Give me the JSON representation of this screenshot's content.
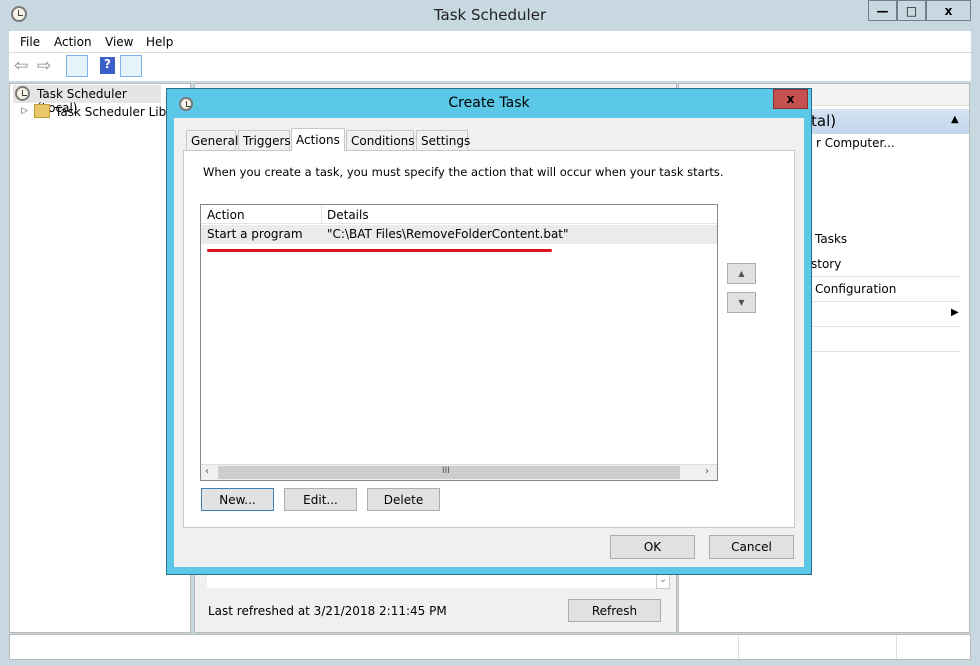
{
  "window": {
    "title": "Task Scheduler",
    "controls": {
      "minimize": "—",
      "maximize": "□",
      "close": "x"
    }
  },
  "menu": [
    "File",
    "Action",
    "View",
    "Help"
  ],
  "toolbar": {
    "icons": [
      "back-arrow-icon",
      "forward-arrow-icon",
      "show-hide-console-tree-icon",
      "help-icon",
      "show-hide-action-pane-icon"
    ]
  },
  "tree": {
    "items": [
      {
        "label": "Task Scheduler (Local)"
      },
      {
        "label": "Task Scheduler Librar"
      }
    ]
  },
  "middle": {
    "last_refreshed": "Last refreshed at 3/21/2018 2:11:45 PM",
    "refresh_label": "Refresh"
  },
  "actions_pane": {
    "header": "tal)",
    "items": [
      "r Computer...",
      "Tasks",
      "story",
      "Configuration"
    ]
  },
  "dialog": {
    "title": "Create Task",
    "close": "x",
    "tabs": [
      "General",
      "Triggers",
      "Actions",
      "Conditions",
      "Settings"
    ],
    "active_tab": "Actions",
    "description": "When you create a task, you must specify the action that will occur when your task starts.",
    "columns": [
      "Action",
      "Details"
    ],
    "rows": [
      {
        "action": "Start a program",
        "details": "\"C:\\BAT Files\\RemoveFolderContent.bat\""
      }
    ],
    "buttons": {
      "new": "New...",
      "edit": "Edit...",
      "delete": "Delete",
      "ok": "OK",
      "cancel": "Cancel"
    },
    "scroll_grip": "III",
    "accent": "#5bc8e8",
    "annotation_color": "#e0141c"
  }
}
